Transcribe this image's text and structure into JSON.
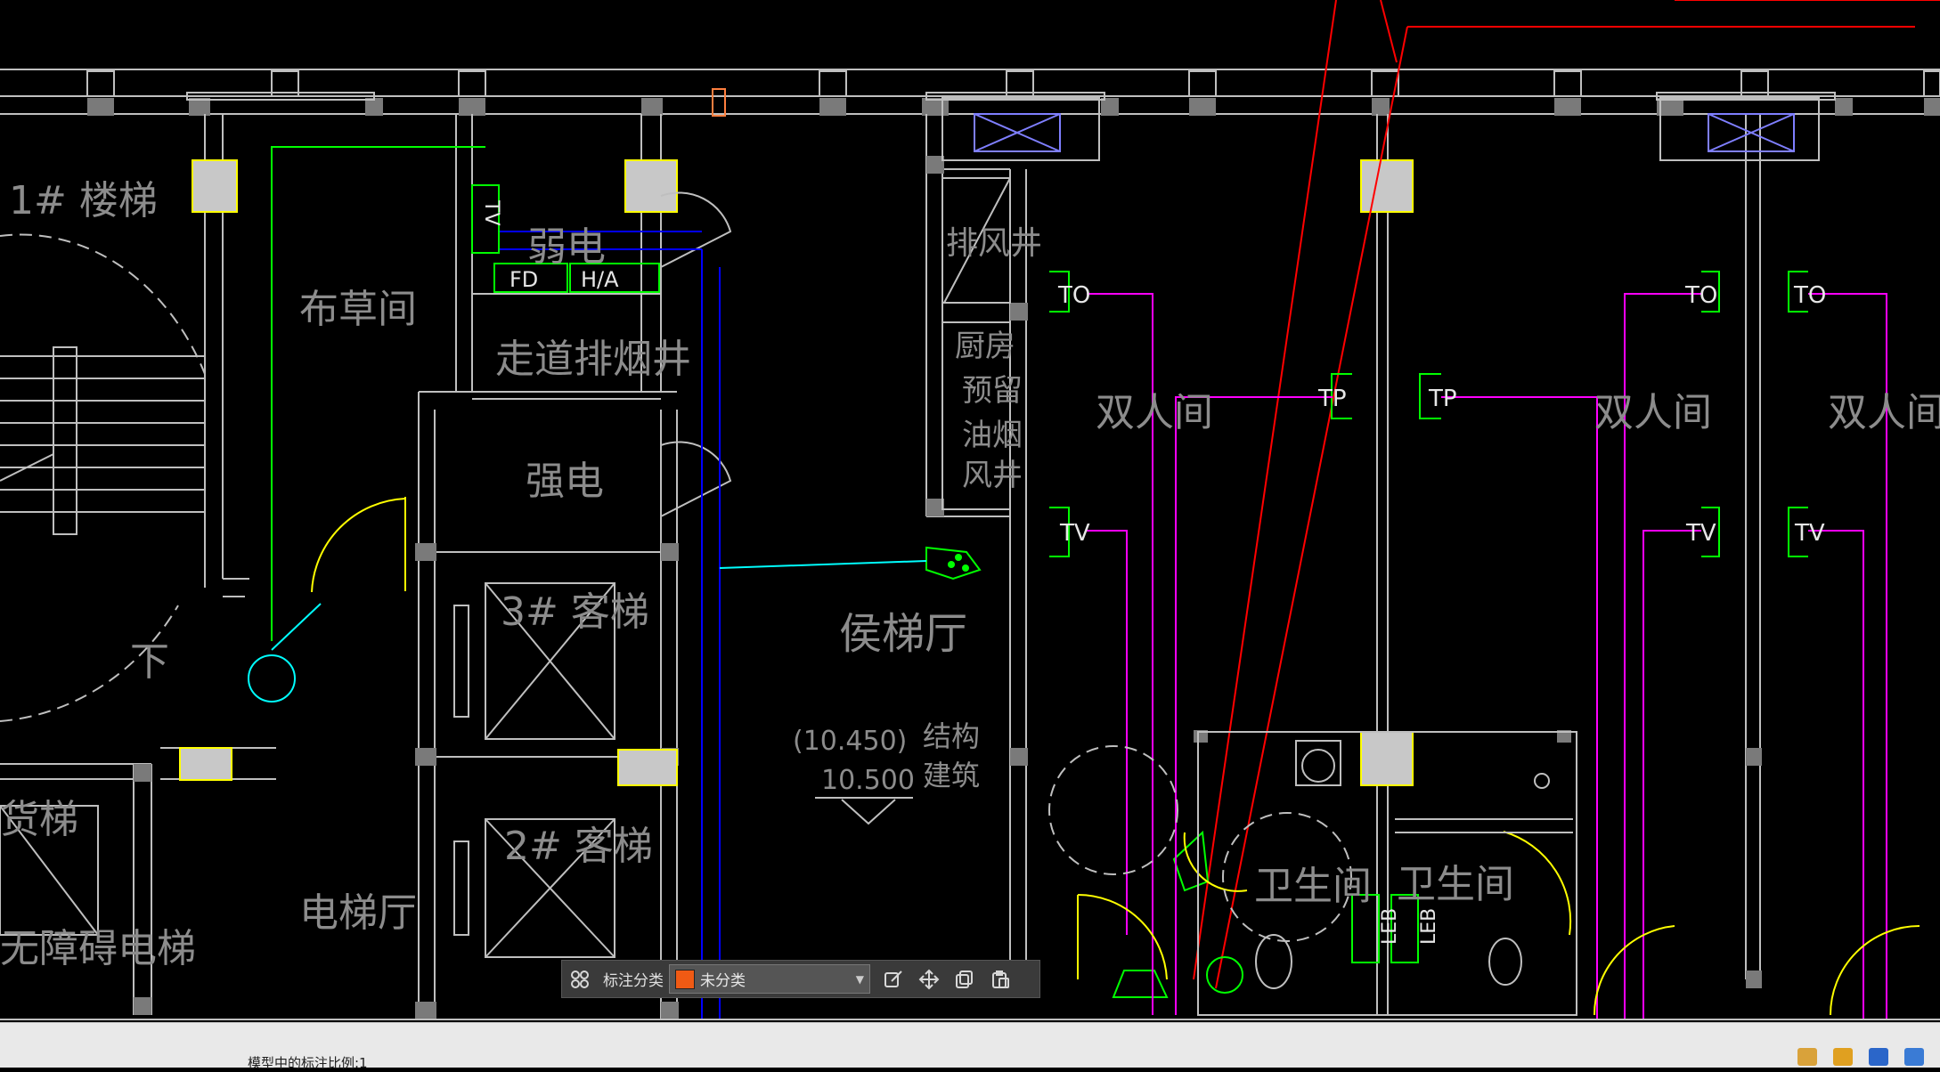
{
  "drawing": {
    "rooms": {
      "stair_1": "1# 楼梯",
      "cloth_room": "布草间",
      "weak_power": "弱电",
      "corridor_smoke": "走道排烟井",
      "strong_power": "强电",
      "exhaust_shaft": "排风井",
      "kitchen_reserve": [
        "厨房",
        "预留",
        "油烟",
        "风井"
      ],
      "elevator_3": "3# 客梯",
      "elevator_2": "2# 客梯",
      "elevator_lobby": "侯梯厅",
      "elevator_hall": "电梯厅",
      "freight_elevator": "货梯",
      "accessible_elevator": "无障碍电梯",
      "twin_room_1": "双人间",
      "twin_room_2": "双人间",
      "twin_room_3": "双人间",
      "toilet_1": "卫生间",
      "toilet_2": "卫生间",
      "stair_down": "下"
    },
    "elevation": {
      "structure_value": "(10.450)",
      "building_value": "10.500",
      "structure_label": "结构",
      "building_label": "建筑"
    },
    "devices": {
      "fd": "FD",
      "ha": "H/A",
      "tv_vertical": "TV",
      "to_left": "TO",
      "tv_left": "TV",
      "tp_1": "TP",
      "tp_2": "TP",
      "to_r1": "TO",
      "to_r2": "TO",
      "tv_r1": "TV",
      "tv_r2": "TV",
      "leb_1": "LEB",
      "leb_2": "LEB"
    },
    "colors": {
      "wall": "#bfbfbf",
      "device": "#00ff00",
      "cable": "#ff00ff",
      "red_line": "#ff0000",
      "door": "#ffff00",
      "blue_duct": "#0000ff",
      "cyan": "#00ffff"
    }
  },
  "toolbar": {
    "grid_icon": "grid-icon",
    "category_label": "标注分类",
    "category_value": "未分类",
    "category_color": "#f05a14",
    "edit_icon": "edit-icon",
    "move_icon": "move-icon",
    "copy_icon": "copy-icon",
    "paste_icon": "paste-icon"
  },
  "status": {
    "text": "模型中的标注比例:1"
  }
}
